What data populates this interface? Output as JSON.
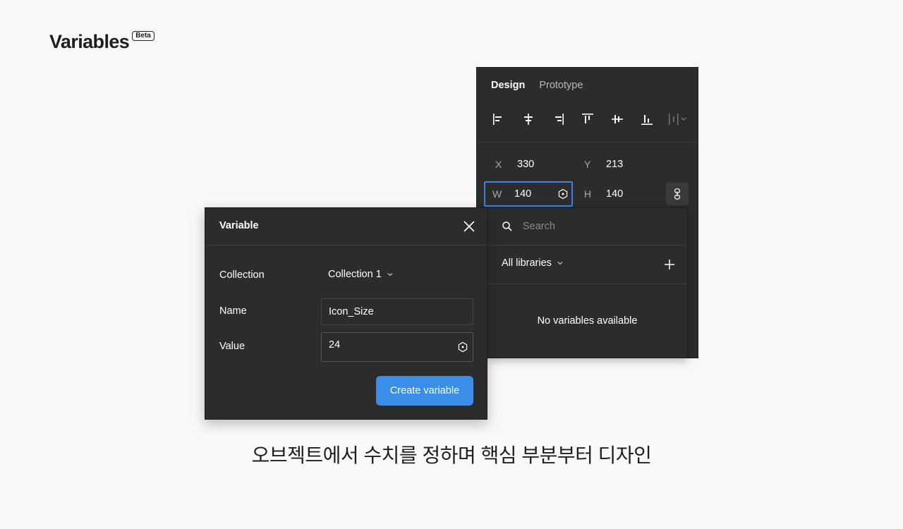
{
  "brand": {
    "title": "Variables",
    "badge": "Beta"
  },
  "design_panel": {
    "tabs": [
      {
        "label": "Design",
        "active": true
      },
      {
        "label": "Prototype",
        "active": false
      }
    ],
    "align_icons": [
      "align-left-icon",
      "align-horizontal-center-icon",
      "align-right-icon",
      "align-top-icon",
      "align-vertical-center-icon",
      "align-bottom-icon",
      "distribute-menu-icon"
    ],
    "x": {
      "label": "X",
      "value": "330"
    },
    "y": {
      "label": "Y",
      "value": "213"
    },
    "w": {
      "label": "W",
      "value": "140"
    },
    "h": {
      "label": "H",
      "value": "140"
    }
  },
  "variables_dropdown": {
    "search_placeholder": "Search",
    "library_select": "All libraries",
    "empty_message": "No variables available"
  },
  "variable_dialog": {
    "title": "Variable",
    "collection_label": "Collection",
    "collection_value": "Collection 1",
    "name_label": "Name",
    "name_value": "Icon_Size",
    "value_label": "Value",
    "value_value": "24",
    "create_button": "Create variable"
  },
  "caption": "오브젝트에서 수치를 정하며 핵심 부분부터 디자인",
  "colors": {
    "background": "#f9f9f9",
    "panel": "#2c2c2c",
    "accent": "#3b8ee8",
    "focus_border": "#3b82e6"
  }
}
